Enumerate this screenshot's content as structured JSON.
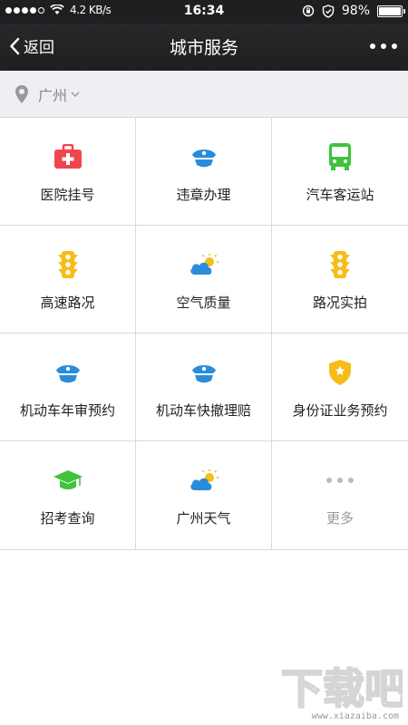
{
  "status_bar": {
    "net_speed": "4.2 KB/s",
    "time": "16:34",
    "battery": "98%",
    "battery_level": 0.98
  },
  "nav": {
    "back_label": "返回",
    "title": "城市服务"
  },
  "location": {
    "city": "广州"
  },
  "services": [
    {
      "label": "医院挂号",
      "icon": "medical-kit-icon",
      "color": "#f0454f"
    },
    {
      "label": "违章办理",
      "icon": "police-cap-icon",
      "color": "#2a8ddb"
    },
    {
      "label": "汽车客运站",
      "icon": "bus-icon",
      "color": "#3ec33a"
    },
    {
      "label": "高速路况",
      "icon": "traffic-light-icon",
      "color": "#f6bd16"
    },
    {
      "label": "空气质量",
      "icon": "weather-icon",
      "color": "#2a8ddb"
    },
    {
      "label": "路况实拍",
      "icon": "traffic-light-icon",
      "color": "#f6bd16"
    },
    {
      "label": "机动车年审预约",
      "icon": "police-cap-icon",
      "color": "#2a8ddb"
    },
    {
      "label": "机动车快撤理赔",
      "icon": "police-cap-icon",
      "color": "#2a8ddb"
    },
    {
      "label": "身份证业务预约",
      "icon": "badge-shield-icon",
      "color": "#f6bd16"
    },
    {
      "label": "招考查询",
      "icon": "graduation-cap-icon",
      "color": "#3ec33a"
    },
    {
      "label": "广州天气",
      "icon": "weather-icon",
      "color": "#2a8ddb"
    },
    {
      "label": "更多",
      "icon": "more-dots-icon",
      "color": "#bbbbbb"
    }
  ],
  "watermark": {
    "url": "www.xiazaiba.com"
  }
}
